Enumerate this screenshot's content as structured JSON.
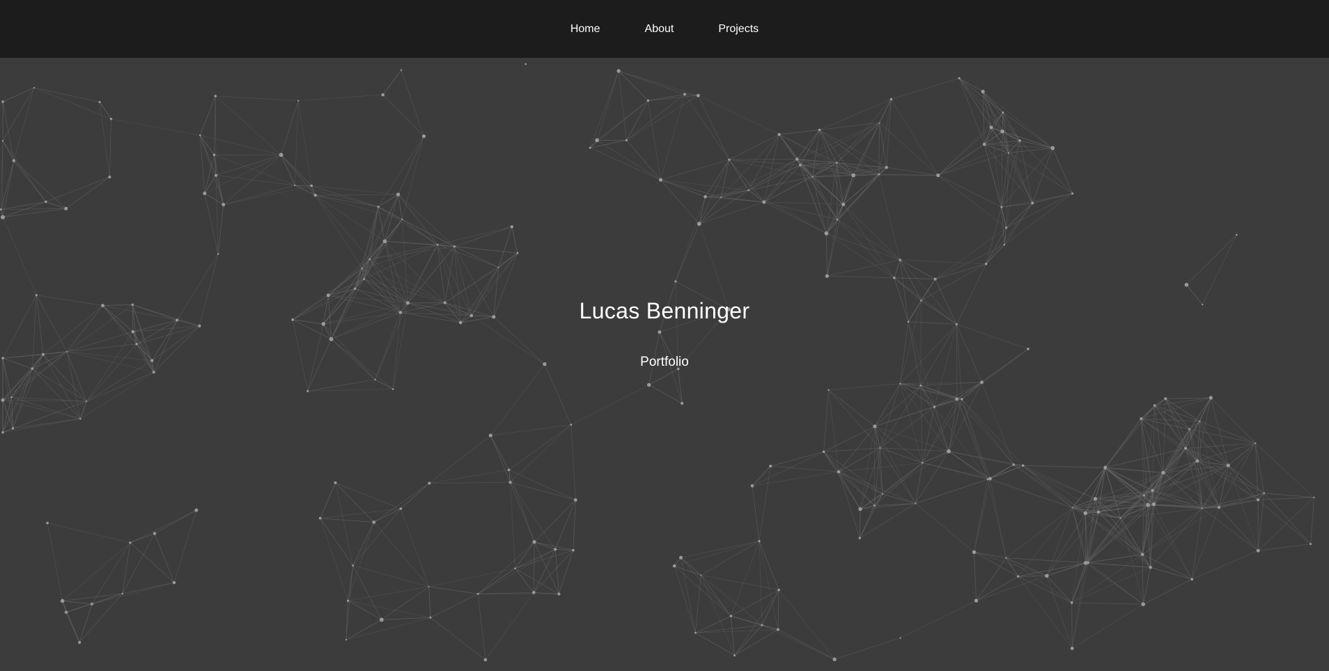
{
  "nav": {
    "items": [
      {
        "label": "Home"
      },
      {
        "label": "About"
      },
      {
        "label": "Projects"
      }
    ]
  },
  "hero": {
    "title": "Lucas Benninger",
    "subtitle": "Portfolio"
  },
  "colors": {
    "navbar_bg": "#1c1c1c",
    "hero_bg": "#3c3c3c",
    "text": "#ffffff",
    "particle": "#9a9a9a",
    "link_line": "#6a6a6a"
  }
}
